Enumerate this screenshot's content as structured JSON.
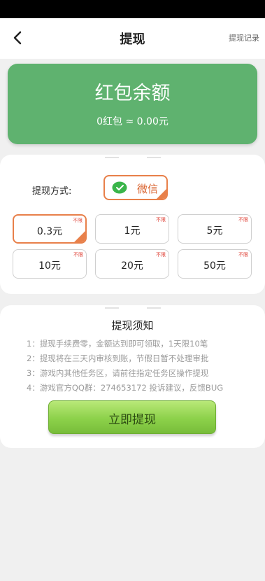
{
  "header": {
    "title": "提现",
    "record_link": "提现记录"
  },
  "balance": {
    "title": "红包余额",
    "summary": "0红包 ≈ 0.00元"
  },
  "withdraw": {
    "method_label": "提现方式:",
    "method_option": "微信",
    "amounts": [
      {
        "value": "0.3元",
        "tag": "不限",
        "selected": true
      },
      {
        "value": "1元",
        "tag": "不限",
        "selected": false
      },
      {
        "value": "5元",
        "tag": "不限",
        "selected": false
      },
      {
        "value": "10元",
        "tag": "不限",
        "selected": false
      },
      {
        "value": "20元",
        "tag": "不限",
        "selected": false
      },
      {
        "value": "50元",
        "tag": "不限",
        "selected": false
      }
    ]
  },
  "notice": {
    "title": "提现须知",
    "lines": [
      "1：提现手续费零，金额达到即可领取，1天限10笔",
      "2：提现将在三天内审核到账，节假日暂不处理审批",
      "3：游戏内其他任务区，请前往指定任务区操作提现",
      "4：游戏官方QQ群：274653172 投诉建议，反馈BUG"
    ]
  },
  "actions": {
    "submit_label": "立即提现"
  },
  "colors": {
    "balance_card": "#5fb26f",
    "accent_orange": "#e8804a",
    "tag_red": "#e0443a",
    "button_green": "#8cd14a"
  }
}
